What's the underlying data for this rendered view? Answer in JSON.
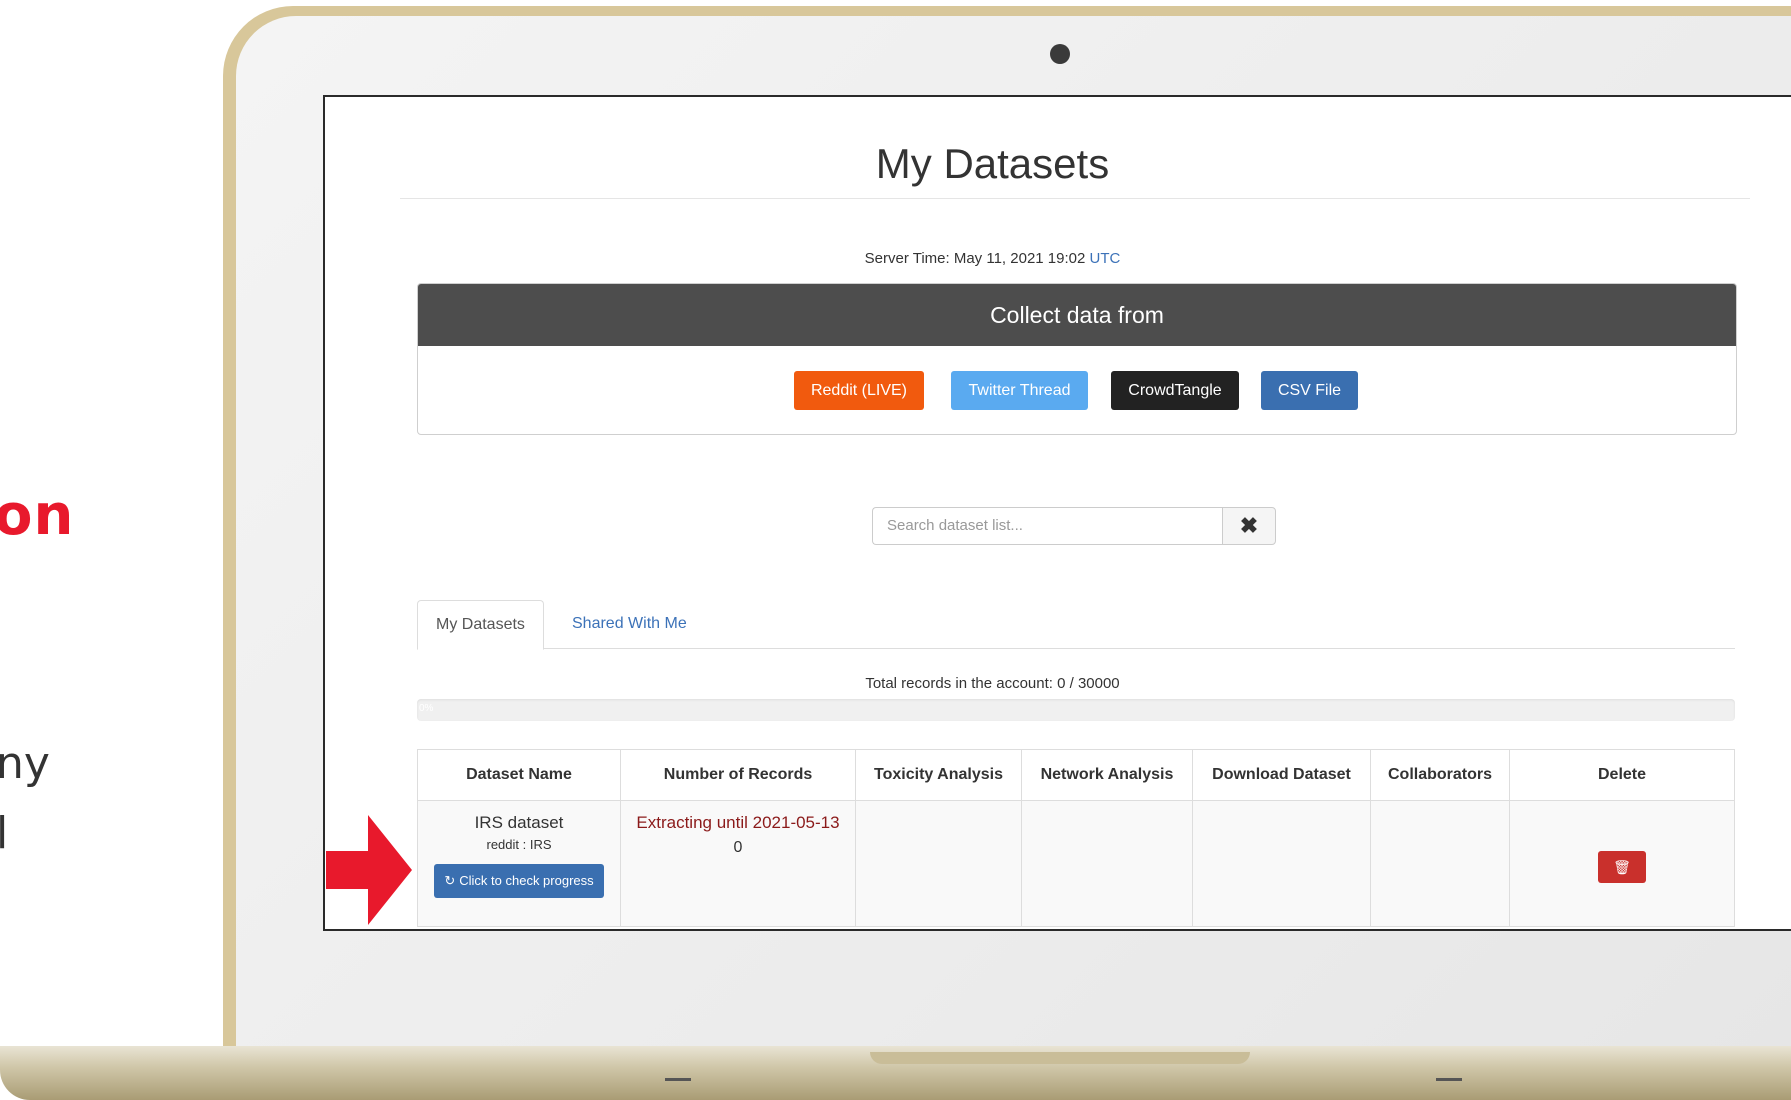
{
  "side_text": {
    "heading_fragment": "on",
    "body_fragment_1": "ny",
    "body_fragment_2": "l"
  },
  "page": {
    "title": "My Datasets"
  },
  "server_time": {
    "label": "Server Time: May 11, 2021 19:02",
    "zone": "UTC"
  },
  "collect": {
    "heading": "Collect data from",
    "buttons": [
      "Reddit (LIVE)",
      "Twitter Thread",
      "CrowdTangle",
      "CSV File"
    ]
  },
  "search": {
    "placeholder": "Search dataset list...",
    "clear_icon": "✖"
  },
  "tabs": [
    "My Datasets",
    "Shared With Me"
  ],
  "account": {
    "total_label": "Total records in the account: 0 / 30000",
    "progress_label": "0%",
    "progress_fraction": 0
  },
  "table": {
    "headers": [
      "Dataset Name",
      "Number of Records",
      "Toxicity Analysis",
      "Network Analysis",
      "Download Dataset",
      "Collaborators",
      "Delete"
    ],
    "rows": [
      {
        "name": "IRS dataset",
        "source": "reddit : IRS",
        "progress_button": "Click to check progress",
        "status": "Extracting until 2021-05-13",
        "records": "0"
      }
    ]
  },
  "colors": {
    "accent_red": "#e8192c",
    "reddit": "#f15a0e",
    "twitter": "#5aaaf0",
    "crowdtangle": "#222222",
    "csv": "#3a6fb0",
    "delete": "#c9302c"
  }
}
